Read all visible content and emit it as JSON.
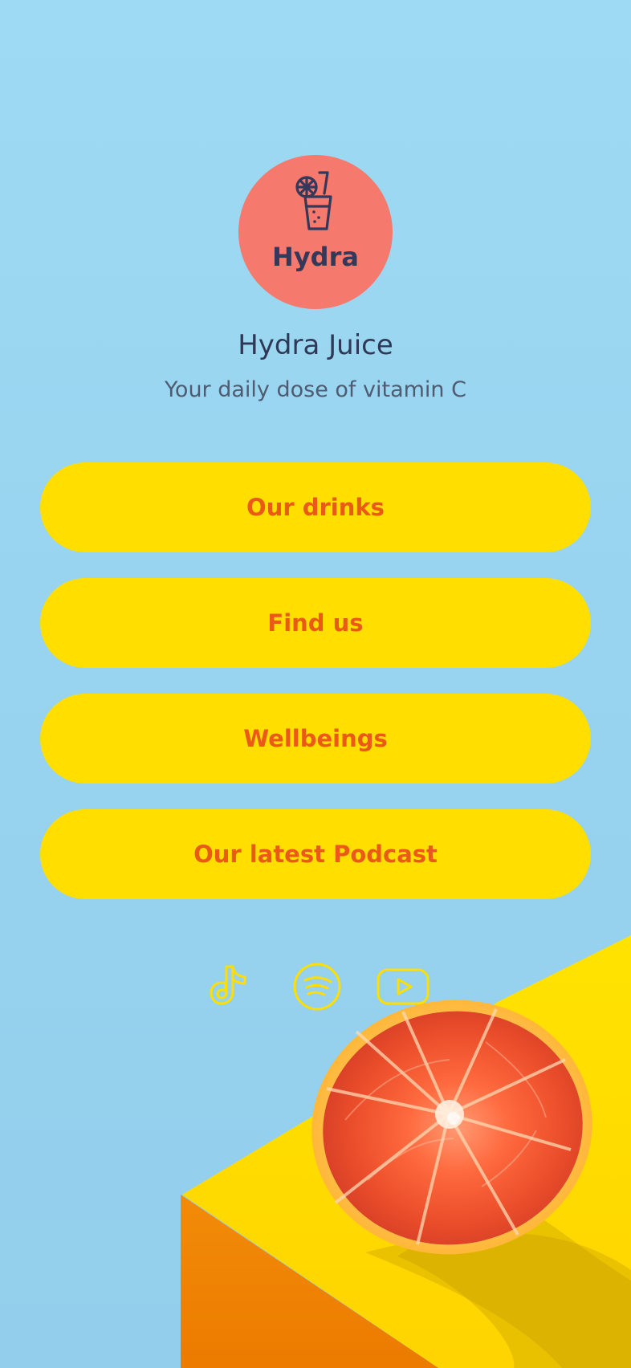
{
  "brand": {
    "logo_text": "Hydra",
    "name": "Hydra Juice",
    "tagline": "Your daily dose of vitamin C"
  },
  "links": [
    {
      "label": "Our drinks"
    },
    {
      "label": "Find us"
    },
    {
      "label": "Wellbeings"
    },
    {
      "label": "Our latest Podcast"
    }
  ],
  "social": [
    {
      "icon": "tiktok-icon"
    },
    {
      "icon": "spotify-icon"
    },
    {
      "icon": "youtube-icon"
    }
  ],
  "colors": {
    "background": "#9ad6f1",
    "avatar": "#f5796c",
    "button": "#ffde00",
    "button_text": "#ea5a16",
    "text_primary": "#2f3957",
    "text_secondary": "#4e5b70",
    "icon_outline": "#ffde00"
  }
}
